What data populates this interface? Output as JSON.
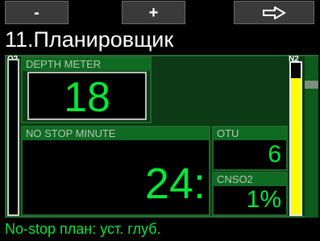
{
  "softkeys": {
    "left_label": "-",
    "center_label": "+",
    "right_icon": "arrow-right-icon"
  },
  "title": "11.Планировщик",
  "depth": {
    "label": "DEPTH    METER",
    "value": "18"
  },
  "no_stop": {
    "label": "NO STOP    MINUTE",
    "value": "24:"
  },
  "otu": {
    "label": "OTU",
    "value": "6"
  },
  "cns": {
    "label": "CNSO2",
    "value": "1%"
  },
  "gauges": {
    "o2_label": "O2",
    "n2_label": "N2",
    "n2_level": 0.9
  },
  "status": "No-stop план: уст. глуб.",
  "colors": {
    "accent_green": "#00e83a",
    "label_green": "#0f6a22",
    "panel_dark": "#0b3a14",
    "n2_yellow": "#ffff00"
  }
}
